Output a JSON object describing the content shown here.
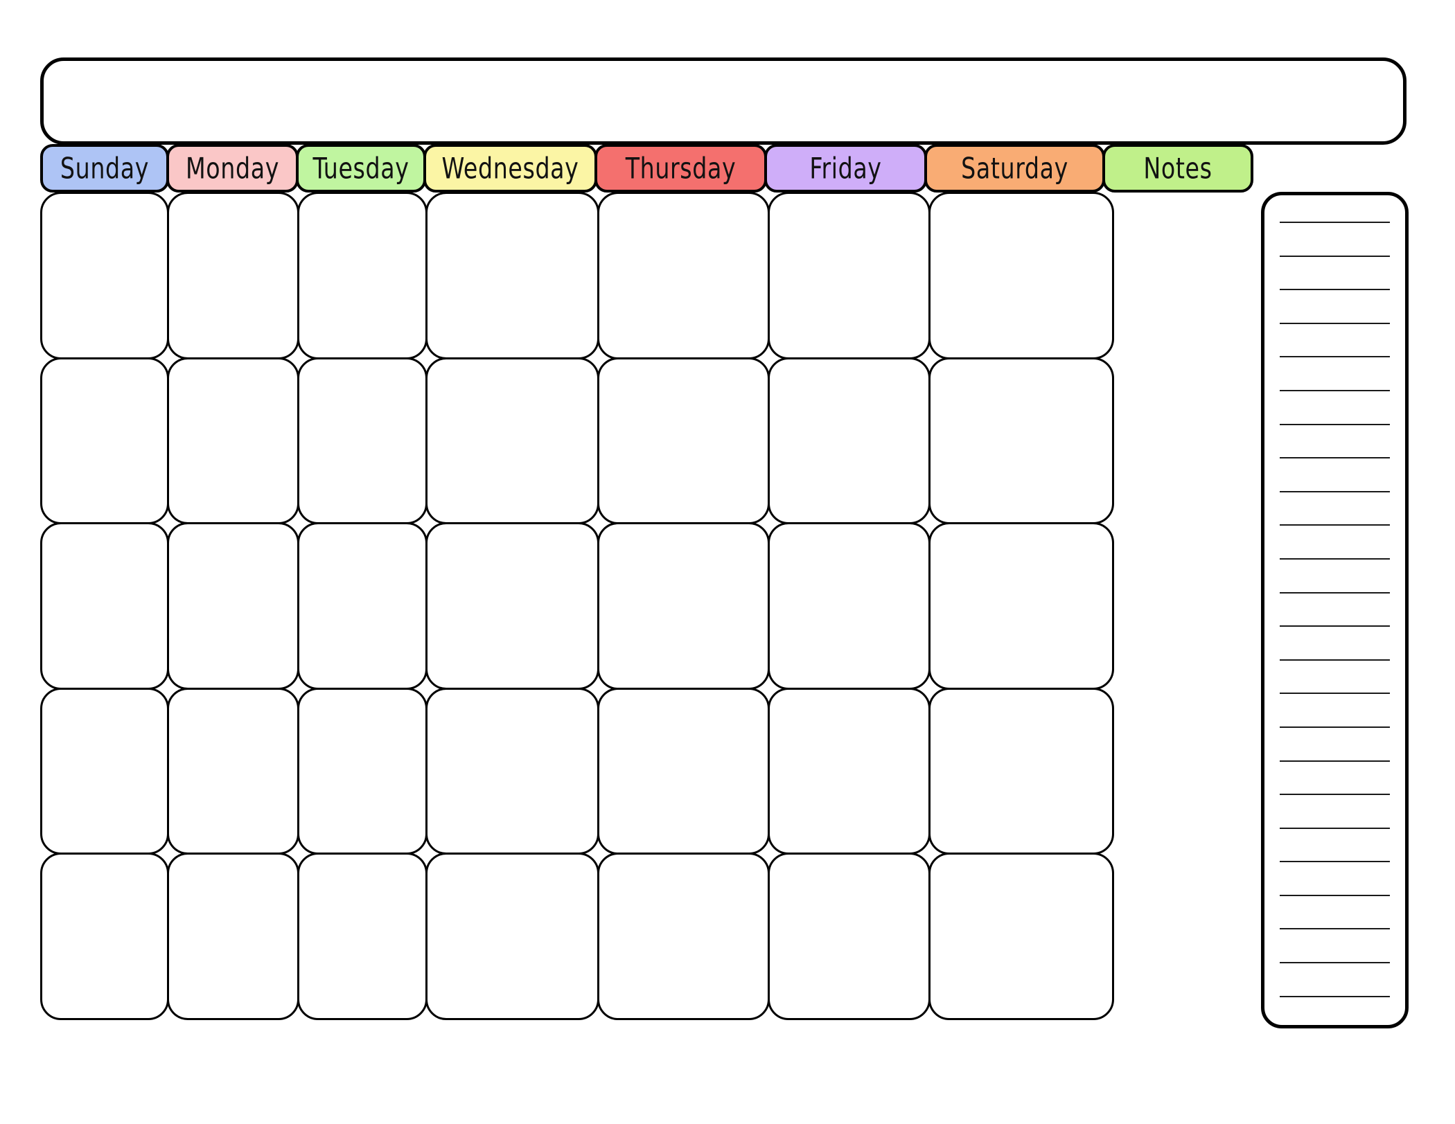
{
  "page": {
    "type": "blank-monthly-calendar-template",
    "background_color": "#ffffff",
    "border_color": "#000000"
  },
  "title_bar": {
    "name": "month-title-bar",
    "value": "",
    "placeholder": ""
  },
  "header": {
    "days": [
      {
        "label": "Sunday",
        "color": "#aec4f5"
      },
      {
        "label": "Monday",
        "color": "#fac7c7"
      },
      {
        "label": "Tuesday",
        "color": "#c0f5a0"
      },
      {
        "label": "Wednesday",
        "color": "#fbf5a5"
      },
      {
        "label": "Thursday",
        "color": "#f4706e"
      },
      {
        "label": "Friday",
        "color": "#cfaef9"
      },
      {
        "label": "Saturday",
        "color": "#f9ac74"
      },
      {
        "label": "Notes",
        "color": "#c0f08a"
      }
    ]
  },
  "grid": {
    "columns": 7,
    "rows": 5,
    "cells": [
      [
        "",
        "",
        "",
        "",
        "",
        "",
        ""
      ],
      [
        "",
        "",
        "",
        "",
        "",
        "",
        ""
      ],
      [
        "",
        "",
        "",
        "",
        "",
        "",
        ""
      ],
      [
        "",
        "",
        "",
        "",
        "",
        "",
        ""
      ],
      [
        "",
        "",
        "",
        "",
        "",
        "",
        ""
      ]
    ]
  },
  "notes": {
    "title": "Notes",
    "line_count": 24,
    "lines": [
      "",
      "",
      "",
      "",
      "",
      "",
      "",
      "",
      "",
      "",
      "",
      "",
      "",
      "",
      "",
      "",
      "",
      "",
      "",
      "",
      "",
      "",
      "",
      ""
    ]
  }
}
